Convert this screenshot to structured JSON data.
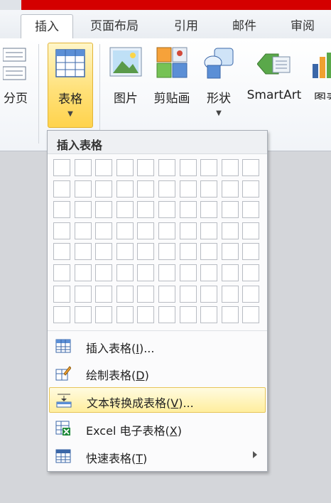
{
  "tabs": [
    {
      "label": "插入",
      "active": true
    },
    {
      "label": "页面布局"
    },
    {
      "label": "引用"
    },
    {
      "label": "邮件"
    },
    {
      "label": "审阅"
    }
  ],
  "ribbon": {
    "page_break_label": "分页",
    "table_label": "表格",
    "picture_label": "图片",
    "clipart_label": "剪贴画",
    "shapes_label": "形状",
    "smartart_label": "SmartArt",
    "chart_label": "图表"
  },
  "dropdown": {
    "title": "插入表格",
    "grid_cols": 10,
    "grid_rows": 8,
    "items": [
      {
        "label": "插入表格(",
        "key": "I",
        "suffix": ")...",
        "icon": "insert-table-icon"
      },
      {
        "label": "绘制表格(",
        "key": "D",
        "suffix": ")",
        "icon": "draw-table-icon"
      },
      {
        "label": "文本转换成表格(",
        "key": "V",
        "suffix": ")...",
        "icon": "convert-text-to-table-icon",
        "highlighted": true
      },
      {
        "label": "Excel 电子表格(",
        "key": "X",
        "suffix": ")",
        "icon": "excel-spreadsheet-icon"
      },
      {
        "label": "快速表格(",
        "key": "T",
        "suffix": ")",
        "icon": "quick-tables-icon",
        "submenu": true
      }
    ]
  },
  "colors": {
    "accent_red": "#d40000",
    "highlight": "#ffee9e",
    "table_btn": "#ffd34d"
  }
}
